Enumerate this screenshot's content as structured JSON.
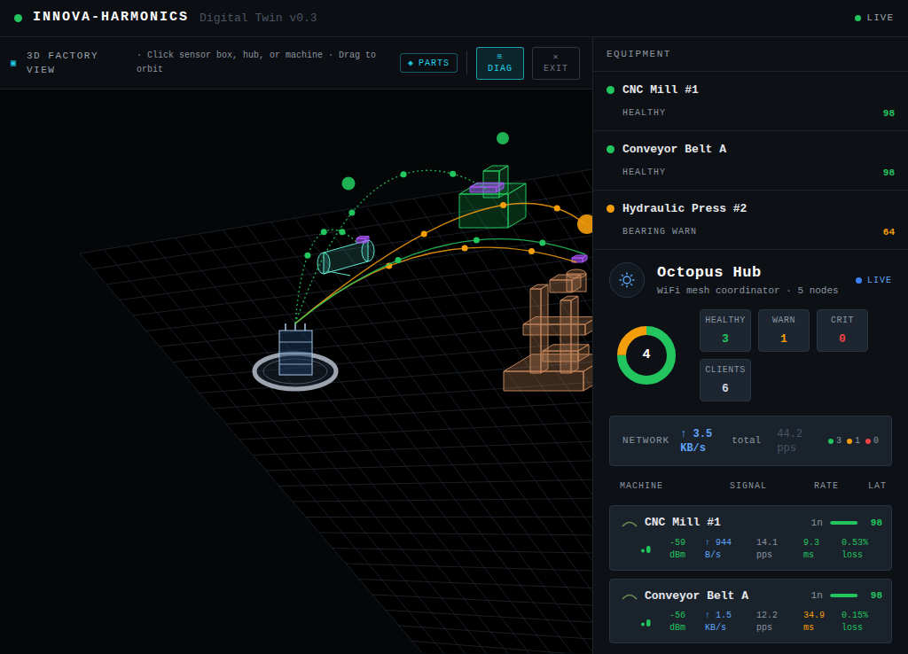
{
  "header": {
    "title": "INNOVA-HARMONICS",
    "subtitle": "Digital Twin v0.3",
    "status": "LIVE",
    "status_color": "#22c55e"
  },
  "toolbar": {
    "icon": "▣",
    "title": "3D FACTORY VIEW",
    "hint": "· Click sensor box, hub, or machine · Drag to orbit",
    "buttons": [
      {
        "icon": "◈",
        "label": "PARTS",
        "selected": false,
        "color": "#22d3ee",
        "kind": "inline"
      },
      {
        "icon": "≡",
        "label": "DIAG",
        "selected": true,
        "color": "#22d3ee",
        "kind": "stacked"
      },
      {
        "icon": "✕",
        "label": "EXIT",
        "selected": false,
        "color": "#6b7280",
        "kind": "stacked"
      }
    ]
  },
  "scene": {
    "links": [
      {
        "color": "#22c55e"
      },
      {
        "color": "#22c55e"
      },
      {
        "color": "#f59e0b"
      },
      {
        "color": "#f59e0b"
      },
      {
        "color": "#22c55e"
      }
    ],
    "sensors": [
      {
        "color": "#22c55e"
      },
      {
        "color": "#22c55e"
      },
      {
        "color": "#f59e0b"
      }
    ]
  },
  "equipment": {
    "title": "EQUIPMENT",
    "items": [
      {
        "name": "CNC Mill #1",
        "status": "HEALTHY",
        "score": "98",
        "color": "#22c55e"
      },
      {
        "name": "Conveyor Belt A",
        "status": "HEALTHY",
        "score": "98",
        "color": "#22c55e"
      },
      {
        "name": "Hydraulic Press #2",
        "status": "BEARING WARN",
        "score": "64",
        "color": "#f59e0b"
      }
    ]
  },
  "hub": {
    "name": "Octopus Hub",
    "subtitle": "WiFi mesh coordinator · 5 nodes",
    "status": "LIVE",
    "status_color": "#3b82f6",
    "donut": {
      "center": "4",
      "segments": [
        {
          "value": 3,
          "color": "#22c55e"
        },
        {
          "value": 1,
          "color": "#f59e0b"
        },
        {
          "value": 0,
          "color": "#ef4444"
        }
      ]
    },
    "stats": [
      {
        "label": "HEALTHY",
        "value": "3",
        "color": "#22c55e"
      },
      {
        "label": "WARN",
        "value": "1",
        "color": "#f59e0b"
      },
      {
        "label": "CRIT",
        "value": "0",
        "color": "#ef4444"
      },
      {
        "label": "CLIENTS",
        "value": "6",
        "color": "#cbd5e1"
      }
    ],
    "network": {
      "label": "NETWORK",
      "rate": "↑ 3.5 KB/s",
      "total": "total",
      "pps": "44.2 pps",
      "legend": [
        {
          "value": "3",
          "color": "#22c55e"
        },
        {
          "value": "1",
          "color": "#f59e0b"
        },
        {
          "value": "0",
          "color": "#ef4444"
        }
      ]
    },
    "columns": [
      "MACHINE",
      "SIGNAL",
      "RATE",
      "LAT"
    ],
    "rows": [
      {
        "name": "CNC Mill #1",
        "hops": "1n",
        "level": 0.98,
        "score": "98",
        "color": "#22c55e",
        "metrics": [
          {
            "value": "-59",
            "unit": "dBm",
            "color": "#22c55e"
          },
          {
            "value": "↑ 944",
            "unit": "B/s",
            "color": "#60a5fa"
          },
          {
            "value": "14.1",
            "unit": "pps",
            "color": "#8b95a1"
          },
          {
            "value": "9.3",
            "unit": "ms",
            "color": "#22c55e"
          },
          {
            "value": "0.53%",
            "unit": "loss",
            "color": "#22c55e"
          }
        ]
      },
      {
        "name": "Conveyor Belt A",
        "hops": "1n",
        "level": 0.98,
        "score": "98",
        "color": "#22c55e",
        "metrics": [
          {
            "value": "-56",
            "unit": "dBm",
            "color": "#22c55e"
          },
          {
            "value": "↑ 1.5",
            "unit": "KB/s",
            "color": "#60a5fa"
          },
          {
            "value": "12.2",
            "unit": "pps",
            "color": "#8b95a1"
          },
          {
            "value": "34.9",
            "unit": "ms",
            "color": "#f59e0b"
          },
          {
            "value": "0.15%",
            "unit": "loss",
            "color": "#22c55e"
          }
        ]
      }
    ]
  }
}
